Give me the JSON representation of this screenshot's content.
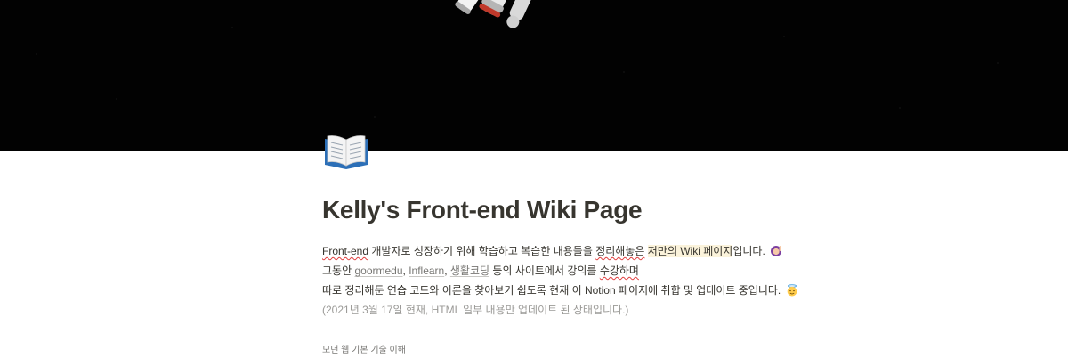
{
  "cover": {
    "alt": "astronaut cover image"
  },
  "page": {
    "icon": "open-book-icon",
    "title": "Kelly's Front-end Wiki Page"
  },
  "intro": {
    "line1": {
      "part1": "Front-end",
      "part2": " 개발자로 성장하기 위해 학습하고 복습한 내용들을 ",
      "part3": "정리해놓은",
      "part4": " ",
      "part5": "저만의 Wiki 페이지",
      "part6": "입니다. ",
      "emoji": "woman-raising-hand-icon"
    },
    "line2": {
      "part1": "그동안 ",
      "link1": "goormedu",
      "sep1": ", ",
      "link2": "Inflearn",
      "sep2": ", ",
      "link3": "생활코딩",
      "part2": " 등의 사이트에서 강의를 ",
      "part3": "수강하며"
    },
    "line3": {
      "text": "따로 정리해둔 연습 코드와 이론을 찾아보기 쉽도록 현재 이 Notion 페이지에 취합 및 업데이트 중입니다. ",
      "emoji": "smiling-face-with-halo-icon"
    },
    "line4": "(2021년 3월 17일 현재, HTML 일부 내용만 업데이트 된 상태입니다.)"
  },
  "section": {
    "heading": "모던 웹 기본 기술 이해"
  }
}
